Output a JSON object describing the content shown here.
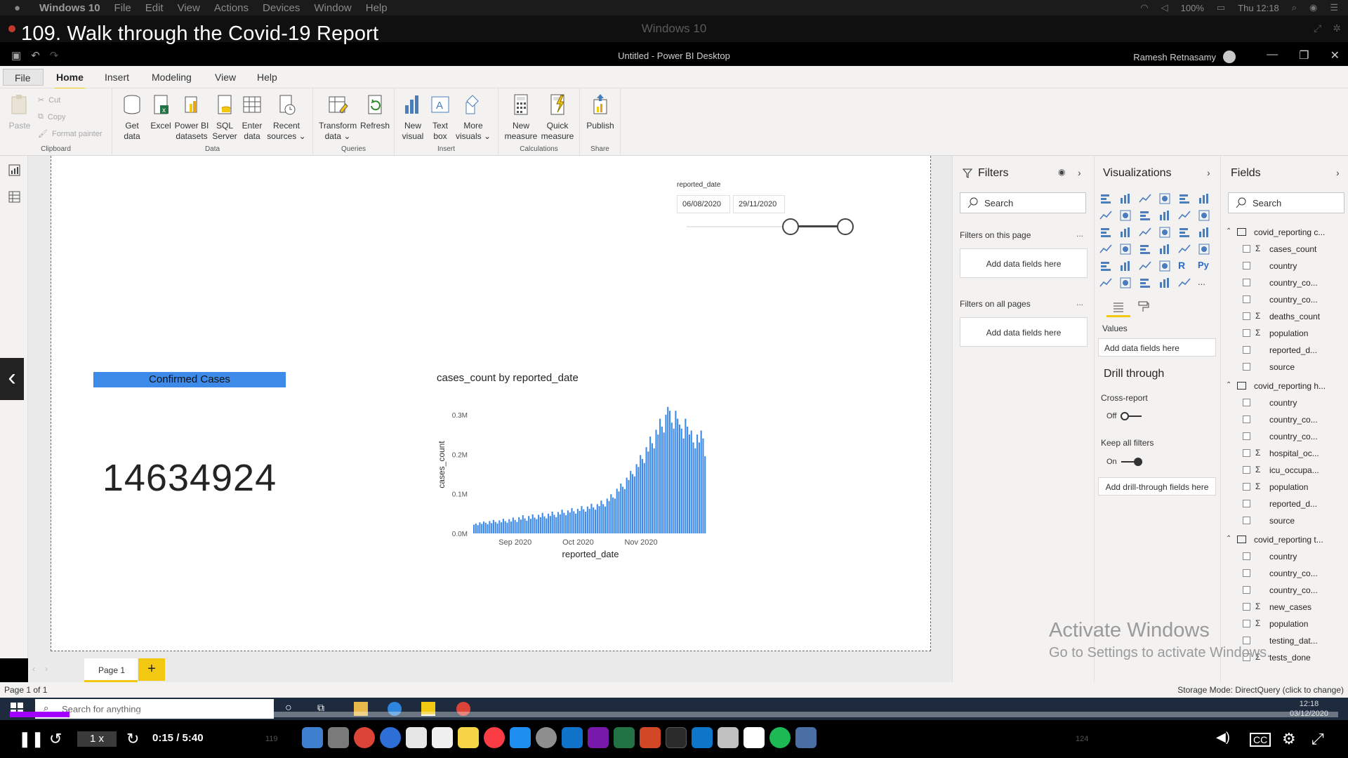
{
  "mac_menubar": {
    "app": "Windows 10",
    "menus": [
      "File",
      "Edit",
      "View",
      "Actions",
      "Devices",
      "Window",
      "Help"
    ],
    "battery": "100%",
    "clock": "Thu 12:18"
  },
  "vm_window": {
    "title": "Windows 10"
  },
  "video_overlay_title": "109. Walk through the Covid-19 Report",
  "pbi_window": {
    "title": "Untitled - Power BI Desktop",
    "user": "Ramesh Retnasamy"
  },
  "ribbon_tabs": {
    "file": "File",
    "home": "Home",
    "insert": "Insert",
    "modeling": "Modeling",
    "view": "View",
    "help": "Help"
  },
  "ribbon": {
    "clipboard": {
      "paste": "Paste",
      "cut": "Cut",
      "copy": "Copy",
      "format_painter": "Format painter",
      "group": "Clipboard"
    },
    "data": {
      "get_data": "Get",
      "get_data2": "data",
      "excel": "Excel",
      "pbi_datasets": "Power BI",
      "pbi_datasets2": "datasets",
      "sql": "SQL",
      "sql2": "Server",
      "enter": "Enter",
      "enter2": "data",
      "recent": "Recent",
      "recent2": "sources",
      "group": "Data"
    },
    "queries": {
      "transform": "Transform",
      "transform2": "data",
      "refresh": "Refresh",
      "group": "Queries"
    },
    "insert": {
      "new_visual": "New",
      "new_visual2": "visual",
      "text_box": "Text",
      "text_box2": "box",
      "more": "More",
      "more2": "visuals",
      "group": "Insert"
    },
    "calculations": {
      "new_measure": "New",
      "new_measure2": "measure",
      "quick_measure": "Quick",
      "quick_measure2": "measure",
      "group": "Calculations"
    },
    "share": {
      "publish": "Publish",
      "group": "Share"
    }
  },
  "slicer": {
    "title": "reported_date",
    "start": "06/08/2020",
    "end": "29/11/2020"
  },
  "card": {
    "title": "Confirmed Cases",
    "value": "14634924",
    "color": "#3d8ae8"
  },
  "chart_title": "cases_count by reported_date",
  "chart_data": {
    "type": "bar",
    "title": "cases_count by reported_date",
    "xlabel": "reported_date",
    "ylabel": "cases_count",
    "ylim": [
      0,
      0.33
    ],
    "y_unit": "M",
    "y_ticks": [
      "0.0M",
      "0.1M",
      "0.2M",
      "0.3M"
    ],
    "x_ticks": [
      "Sep 2020",
      "Oct 2020",
      "Nov 2020"
    ],
    "color": "#3d8ae8",
    "series": [
      {
        "values": [
          0.022,
          0.025,
          0.021,
          0.028,
          0.024,
          0.03,
          0.027,
          0.023,
          0.031,
          0.026,
          0.034,
          0.029,
          0.025,
          0.033,
          0.028,
          0.037,
          0.031,
          0.027,
          0.036,
          0.03,
          0.04,
          0.034,
          0.029,
          0.041,
          0.035,
          0.046,
          0.038,
          0.032,
          0.044,
          0.037,
          0.048,
          0.04,
          0.036,
          0.047,
          0.041,
          0.052,
          0.043,
          0.038,
          0.05,
          0.044,
          0.055,
          0.047,
          0.041,
          0.054,
          0.048,
          0.06,
          0.052,
          0.046,
          0.058,
          0.053,
          0.064,
          0.056,
          0.05,
          0.062,
          0.057,
          0.069,
          0.061,
          0.055,
          0.068,
          0.062,
          0.075,
          0.066,
          0.06,
          0.074,
          0.069,
          0.083,
          0.074,
          0.068,
          0.088,
          0.082,
          0.099,
          0.091,
          0.088,
          0.113,
          0.106,
          0.126,
          0.118,
          0.112,
          0.141,
          0.135,
          0.158,
          0.15,
          0.144,
          0.175,
          0.168,
          0.198,
          0.188,
          0.178,
          0.218,
          0.207,
          0.245,
          0.228,
          0.215,
          0.262,
          0.25,
          0.29,
          0.27,
          0.255,
          0.3,
          0.32,
          0.31,
          0.28,
          0.265,
          0.31,
          0.29,
          0.275,
          0.265,
          0.24,
          0.29,
          0.27,
          0.25,
          0.26,
          0.23,
          0.215,
          0.25,
          0.23,
          0.26,
          0.24,
          0.195
        ]
      }
    ]
  },
  "filters_pane": {
    "title": "Filters",
    "search_placeholder": "Search",
    "on_this_page": "Filters on this page",
    "on_all_pages": "Filters on all pages",
    "add_fields": "Add data fields here",
    "more": "..."
  },
  "viz_pane": {
    "title": "Visualizations",
    "values_label": "Values",
    "add_fields": "Add data fields here",
    "drill_through": "Drill through",
    "cross_report": "Cross-report",
    "cross_report_state": "Off",
    "keep_all_filters": "Keep all filters",
    "keep_state": "On",
    "add_drill": "Add drill-through fields here",
    "r_icon": "R",
    "py_icon": "Py",
    "more": "..."
  },
  "fields_pane": {
    "title": "Fields",
    "search_placeholder": "Search",
    "tables": [
      {
        "name": "covid_reporting c...",
        "fields": [
          {
            "name": "cases_count",
            "sigma": true
          },
          {
            "name": "country",
            "sigma": false
          },
          {
            "name": "country_co...",
            "sigma": false
          },
          {
            "name": "country_co...",
            "sigma": false
          },
          {
            "name": "deaths_count",
            "sigma": true
          },
          {
            "name": "population",
            "sigma": true
          },
          {
            "name": "reported_d...",
            "sigma": false
          },
          {
            "name": "source",
            "sigma": false
          }
        ]
      },
      {
        "name": "covid_reporting h...",
        "fields": [
          {
            "name": "country",
            "sigma": false
          },
          {
            "name": "country_co...",
            "sigma": false
          },
          {
            "name": "country_co...",
            "sigma": false
          },
          {
            "name": "hospital_oc...",
            "sigma": true
          },
          {
            "name": "icu_occupa...",
            "sigma": true
          },
          {
            "name": "population",
            "sigma": true
          },
          {
            "name": "reported_d...",
            "sigma": false
          },
          {
            "name": "source",
            "sigma": false
          }
        ]
      },
      {
        "name": "covid_reporting t...",
        "fields": [
          {
            "name": "country",
            "sigma": false
          },
          {
            "name": "country_co...",
            "sigma": false
          },
          {
            "name": "country_co...",
            "sigma": false
          },
          {
            "name": "new_cases",
            "sigma": true
          },
          {
            "name": "population",
            "sigma": true
          },
          {
            "name": "testing_dat...",
            "sigma": false
          },
          {
            "name": "tests_done",
            "sigma": true
          }
        ]
      }
    ]
  },
  "watermark": {
    "line1": "Activate Windows",
    "line2": "Go to Settings to activate Windows."
  },
  "page_tabs": {
    "page1": "Page 1",
    "add": "+"
  },
  "status": {
    "left": "Page 1 of 1",
    "right": "Storage Mode: DirectQuery (click to change)"
  },
  "taskbar": {
    "search_placeholder": "Search for anything",
    "time": "12:18",
    "date": "03/12/2020"
  },
  "player": {
    "speed": "1 x",
    "time": "0:15 / 5:40",
    "progress": 0.045,
    "badge1": "119",
    "badge2": "124"
  }
}
